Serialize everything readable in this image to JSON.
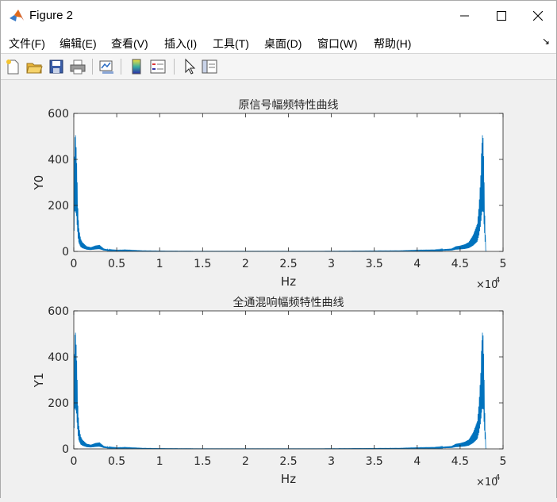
{
  "window": {
    "title": "Figure 2",
    "icon": "matlab-icon",
    "controls": [
      "minimize-icon",
      "maximize-icon",
      "close-icon"
    ]
  },
  "menu": {
    "items": [
      "文件(F)",
      "编辑(E)",
      "查看(V)",
      "插入(I)",
      "工具(T)",
      "桌面(D)",
      "窗口(W)",
      "帮助(H)"
    ],
    "overflow_icon": "dock-arrow-icon"
  },
  "toolbar": {
    "icons": [
      "new-figure-icon",
      "open-file-icon",
      "save-icon",
      "print-icon",
      "link-plot-icon",
      "colorbar-icon",
      "legend-icon",
      "pointer-icon",
      "plot-tools-icon"
    ]
  },
  "chart_data": [
    {
      "type": "line",
      "title": "原信号幅频特性曲线",
      "xlabel": "Hz",
      "ylabel": "Y0",
      "xlim": [
        0,
        50000
      ],
      "ylim": [
        0,
        600
      ],
      "x_ticks": [
        "0",
        "0.5",
        "1",
        "1.5",
        "2",
        "2.5",
        "3",
        "3.5",
        "4",
        "4.5",
        "5"
      ],
      "y_ticks": [
        "0",
        "200",
        "400",
        "600"
      ],
      "x_exponent": "×10",
      "x_exponent_power": "4",
      "color": "#0072bd",
      "series": [
        {
          "x": [
            0,
            100,
            200,
            300,
            400,
            500,
            600,
            800,
            1000,
            1500,
            2000,
            2500,
            3000,
            3500,
            4000,
            5000,
            6000,
            8000,
            10000,
            15000,
            20000,
            24000,
            28000,
            33000,
            38000,
            40000,
            42000,
            44000,
            44500,
            45000,
            45500,
            46000,
            46500,
            47000,
            47200,
            47400,
            47500,
            47600,
            47700,
            47800,
            47900,
            48000
          ],
          "y": [
            100,
            490,
            505,
            440,
            300,
            160,
            100,
            55,
            40,
            22,
            18,
            25,
            28,
            12,
            8,
            5,
            6,
            3,
            2,
            1,
            1,
            1,
            1,
            2,
            3,
            5,
            6,
            12,
            22,
            25,
            30,
            40,
            70,
            120,
            200,
            330,
            450,
            505,
            490,
            300,
            120,
            0
          ]
        }
      ]
    },
    {
      "type": "line",
      "title": "全通混响幅频特性曲线",
      "xlabel": "Hz",
      "ylabel": "Y1",
      "xlim": [
        0,
        50000
      ],
      "ylim": [
        0,
        600
      ],
      "x_ticks": [
        "0",
        "0.5",
        "1",
        "1.5",
        "2",
        "2.5",
        "3",
        "3.5",
        "4",
        "4.5",
        "5"
      ],
      "y_ticks": [
        "0",
        "200",
        "400",
        "600"
      ],
      "x_exponent": "×10",
      "x_exponent_power": "4",
      "color": "#0072bd",
      "series": [
        {
          "x": [
            0,
            100,
            200,
            300,
            400,
            500,
            600,
            800,
            1000,
            1500,
            2000,
            2500,
            3000,
            3500,
            4000,
            5000,
            6000,
            8000,
            10000,
            15000,
            20000,
            24000,
            28000,
            33000,
            38000,
            40000,
            42000,
            44000,
            44500,
            45000,
            45500,
            46000,
            46500,
            47000,
            47200,
            47400,
            47500,
            47600,
            47700,
            47800,
            47900,
            48000
          ],
          "y": [
            100,
            490,
            505,
            440,
            300,
            160,
            100,
            55,
            40,
            22,
            18,
            25,
            28,
            12,
            8,
            5,
            6,
            3,
            2,
            1,
            1,
            1,
            1,
            2,
            3,
            5,
            6,
            12,
            22,
            25,
            30,
            40,
            70,
            120,
            200,
            330,
            450,
            505,
            490,
            300,
            120,
            0
          ]
        }
      ]
    }
  ]
}
